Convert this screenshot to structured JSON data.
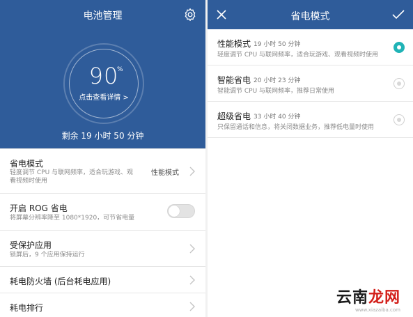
{
  "battery": {
    "title": "电池管理",
    "percent": "90",
    "percent_sign": "%",
    "detail_link": "点击查看详情 >",
    "remaining": "剩余 19 小时 50 分钟",
    "settings": [
      {
        "title": "省电模式",
        "subtitle": "轻度调节 CPU 与联网频率，适合玩游戏、观看视频时使用",
        "value": "性能模式"
      },
      {
        "title": "开启 ROG 省电",
        "subtitle": "将屏幕分辨率降至 1080*1920，可节省电量",
        "toggle_on": false
      },
      {
        "title": "受保护应用",
        "subtitle": "锁屏后，9 个应用保持运行"
      },
      {
        "title": "耗电防火墙 (后台耗电应用)"
      },
      {
        "title": "耗电排行"
      }
    ]
  },
  "power_mode": {
    "title": "省电模式",
    "modes": [
      {
        "name": "性能模式",
        "time": "19 小时 50 分钟",
        "desc": "轻度调节 CPU 与联网频率，适合玩游戏、观看视频时使用",
        "selected": true
      },
      {
        "name": "智能省电",
        "time": "20 小时 23 分钟",
        "desc": "智能调节 CPU 与联网频率，推荐日常使用",
        "selected": false
      },
      {
        "name": "超级省电",
        "time": "33 小时 40 分钟",
        "desc": "只保留通话和信息，将关闭数据业务，推荐低电量时使用",
        "selected": false
      }
    ]
  },
  "watermark": {
    "text_black": "云南",
    "text_red": "龙网",
    "url": "www.xiazaiba.com"
  },
  "icons": [
    "gear-icon",
    "chevron-right-icon",
    "close-icon",
    "check-icon"
  ],
  "colors": {
    "header": "#2f5c9a",
    "accent": "#20b3b6",
    "watermark_red": "#d3201b"
  }
}
